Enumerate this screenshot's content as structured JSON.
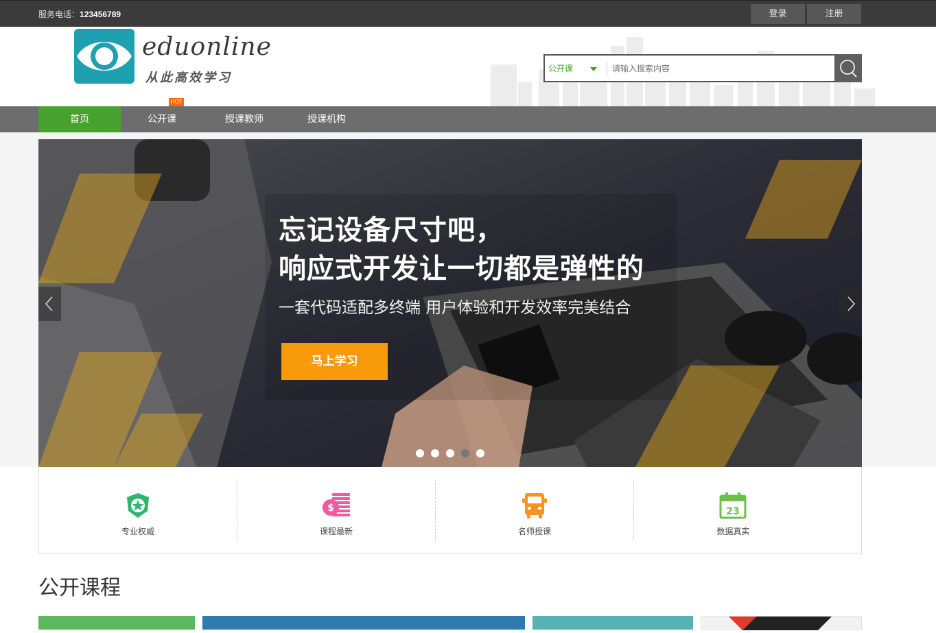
{
  "topbar": {
    "phone_label": "服务电话：",
    "phone_number": "123456789",
    "login": "登录",
    "register": "注册"
  },
  "logo": {
    "wordmark": "eduonline",
    "slogan": "从此高效学习"
  },
  "search": {
    "category": "公开课",
    "placeholder": "请输入搜索内容",
    "button_icon": "search-icon"
  },
  "nav": {
    "items": [
      {
        "label": "首页",
        "active": true
      },
      {
        "label": "公开课",
        "badge": "HOT"
      },
      {
        "label": "授课教师"
      },
      {
        "label": "授课机构"
      }
    ]
  },
  "banner": {
    "headline1": "忘记设备尺寸吧，",
    "headline2": "响应式开发让一切都是弹性的",
    "subtitle": "一套代码适配多终端 用户体验和开发效率完美结合",
    "cta": "马上学习",
    "slides": 5,
    "active_slide": 4
  },
  "features": [
    {
      "label": "专业权威",
      "icon": "shield-star-icon"
    },
    {
      "label": "课程最新",
      "icon": "coin-stack-icon"
    },
    {
      "label": "名师授课",
      "icon": "bus-icon"
    },
    {
      "label": "数据真实",
      "icon": "calendar-icon",
      "icon_text": "23"
    }
  ],
  "section": {
    "title": "公开课程"
  },
  "colors": {
    "topbar": "#3b3b3b",
    "nav": "#6d6d6d",
    "nav_active": "#46a12e",
    "cta": "#f99a0b",
    "logo": "#1fa0b0",
    "hot_badge": "#ff6a00"
  }
}
